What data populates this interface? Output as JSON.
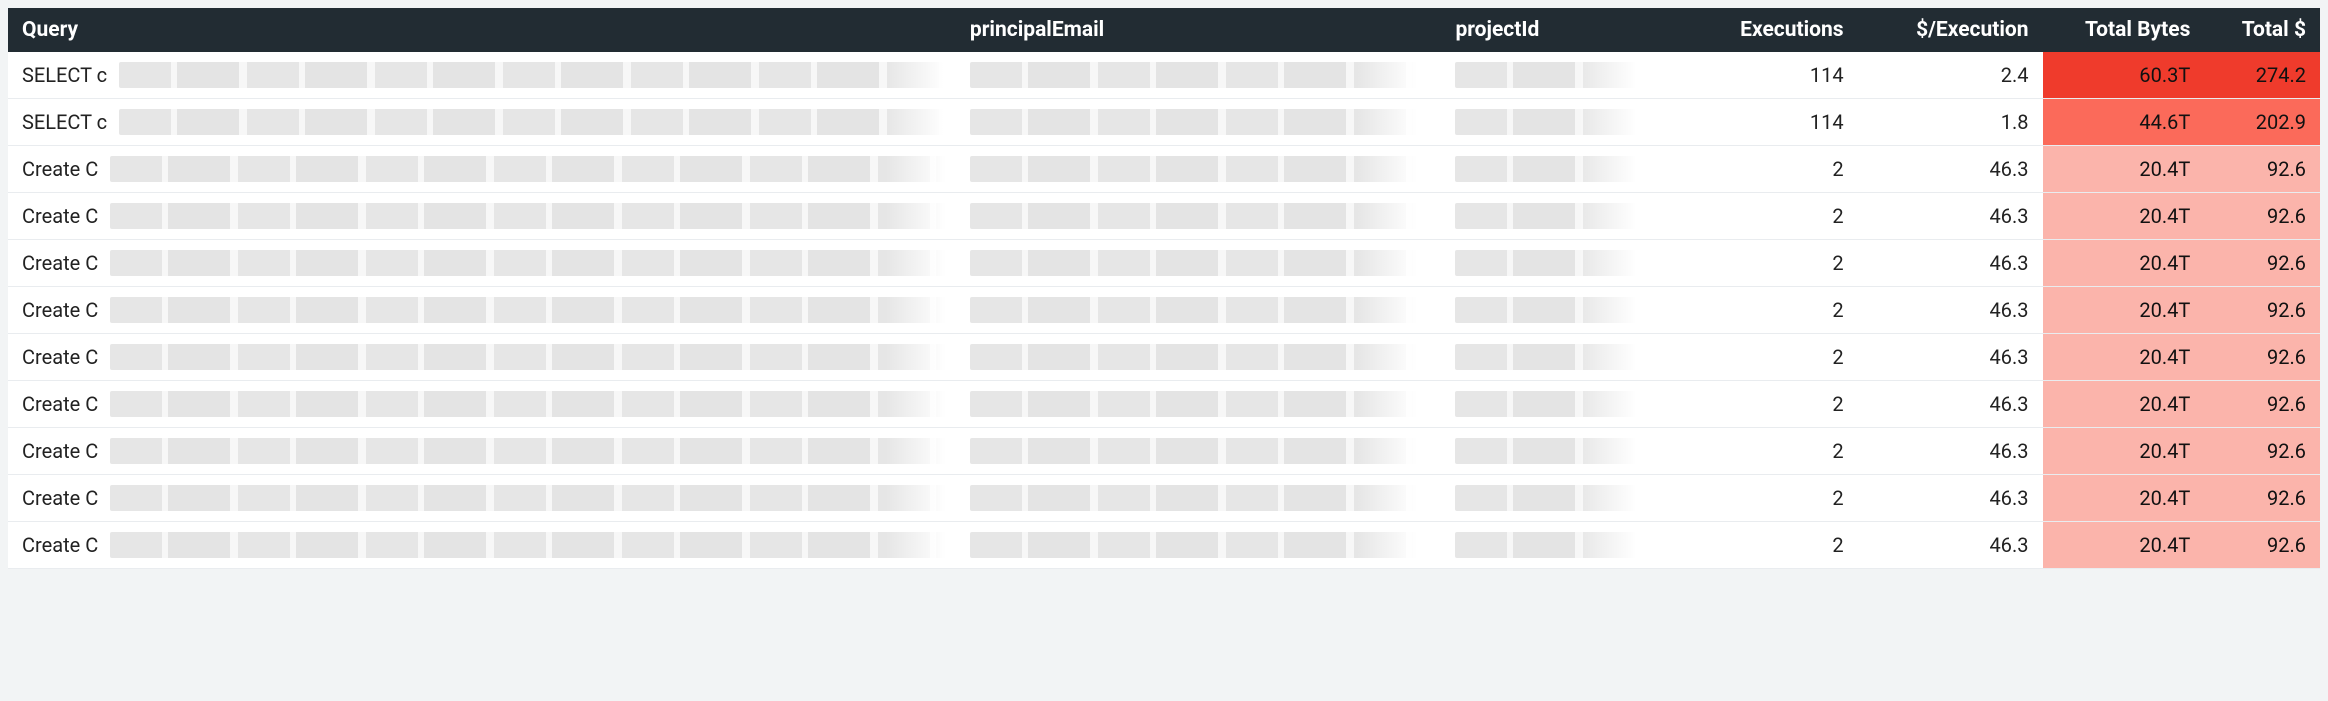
{
  "chart_data": {
    "type": "table",
    "title": "",
    "columns": [
      "Query",
      "principalEmail",
      "projectId",
      "Executions",
      "$/Execution",
      "Total Bytes",
      "Total $"
    ],
    "heat_columns": [
      "Total Bytes",
      "Total $"
    ],
    "rows": [
      {
        "query_prefix": "SELECT c",
        "executions": 114,
        "cost_per_execution": 2.4,
        "total_bytes": "60.3T",
        "total_cost": 274.2,
        "heat": "strong"
      },
      {
        "query_prefix": "SELECT c",
        "executions": 114,
        "cost_per_execution": 1.8,
        "total_bytes": "44.6T",
        "total_cost": 202.9,
        "heat": "mid"
      },
      {
        "query_prefix": "Create C",
        "executions": 2,
        "cost_per_execution": 46.3,
        "total_bytes": "20.4T",
        "total_cost": 92.6,
        "heat": "light"
      },
      {
        "query_prefix": "Create C",
        "executions": 2,
        "cost_per_execution": 46.3,
        "total_bytes": "20.4T",
        "total_cost": 92.6,
        "heat": "light"
      },
      {
        "query_prefix": "Create C",
        "executions": 2,
        "cost_per_execution": 46.3,
        "total_bytes": "20.4T",
        "total_cost": 92.6,
        "heat": "light"
      },
      {
        "query_prefix": "Create C",
        "executions": 2,
        "cost_per_execution": 46.3,
        "total_bytes": "20.4T",
        "total_cost": 92.6,
        "heat": "light"
      },
      {
        "query_prefix": "Create C",
        "executions": 2,
        "cost_per_execution": 46.3,
        "total_bytes": "20.4T",
        "total_cost": 92.6,
        "heat": "light"
      },
      {
        "query_prefix": "Create C",
        "executions": 2,
        "cost_per_execution": 46.3,
        "total_bytes": "20.4T",
        "total_cost": 92.6,
        "heat": "light"
      },
      {
        "query_prefix": "Create C",
        "executions": 2,
        "cost_per_execution": 46.3,
        "total_bytes": "20.4T",
        "total_cost": 92.6,
        "heat": "light"
      },
      {
        "query_prefix": "Create C",
        "executions": 2,
        "cost_per_execution": 46.3,
        "total_bytes": "20.4T",
        "total_cost": 92.6,
        "heat": "light"
      },
      {
        "query_prefix": "Create C",
        "executions": 2,
        "cost_per_execution": 46.3,
        "total_bytes": "20.4T",
        "total_cost": 92.6,
        "heat": "light"
      }
    ]
  },
  "headers": {
    "query": "Query",
    "email": "principalEmail",
    "project": "projectId",
    "executions": "Executions",
    "per_exec": "$/Execution",
    "total_bytes": "Total Bytes",
    "total_cost": "Total $"
  }
}
